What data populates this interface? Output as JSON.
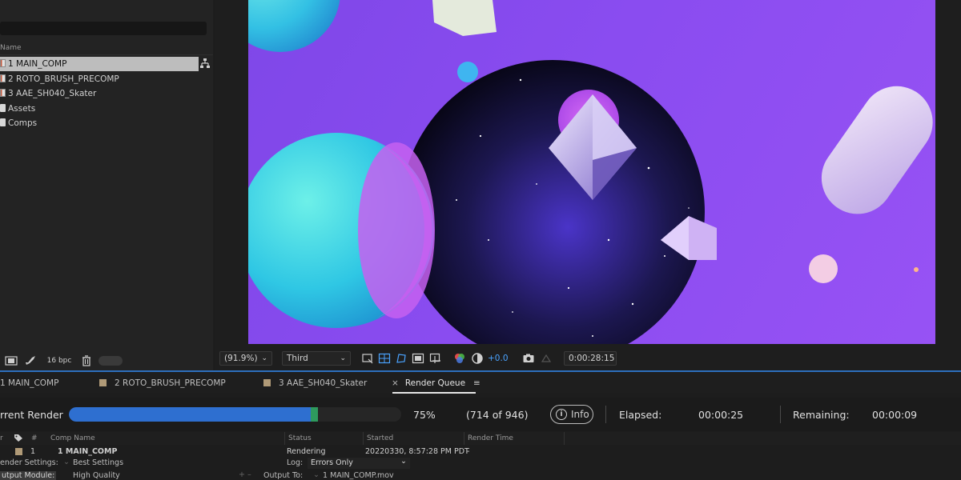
{
  "project": {
    "column_header": "Name",
    "items": [
      {
        "label": "1 MAIN_COMP",
        "type": "comp",
        "selected": true
      },
      {
        "label": "2 ROTO_BRUSH_PRECOMP",
        "type": "comp",
        "selected": false
      },
      {
        "label": "3 AAE_SH040_Skater",
        "type": "comp",
        "selected": false
      },
      {
        "label": "Assets",
        "type": "folder",
        "selected": false
      },
      {
        "label": "Comps",
        "type": "folder",
        "selected": false
      }
    ],
    "bpc": "16 bpc"
  },
  "viewer": {
    "zoom": "(91.9%)",
    "resolution": "Third",
    "exposure": "+0.0",
    "timecode": "0:00:28:15"
  },
  "tabs": [
    {
      "label": "1 MAIN_COMP"
    },
    {
      "label": "2 ROTO_BRUSH_PRECOMP"
    },
    {
      "label": "3 AAE_SH040_Skater"
    },
    {
      "label": "Render Queue",
      "active": true
    }
  ],
  "render_queue": {
    "title": "rrent Render",
    "progress": 0.75,
    "percent_label": "75%",
    "frames_label": "(714 of 946)",
    "info_label": "Info",
    "elapsed_label": "Elapsed:",
    "elapsed_value": "00:00:25",
    "remaining_label": "Remaining:",
    "remaining_value": "00:00:09",
    "columns": {
      "num": "#",
      "comp_name": "Comp Name",
      "status": "Status",
      "started": "Started",
      "render_time": "Render Time"
    },
    "item": {
      "num": "1",
      "comp_name": "1 MAIN_COMP",
      "status": "Rendering",
      "started": "20220330, 8:57:28 PM PDT",
      "render_time": "-"
    },
    "render_settings_label": "ender Settings:",
    "render_settings_value": "Best Settings",
    "log_label": "Log:",
    "log_value": "Errors Only",
    "output_module_label": "utput Module:",
    "output_module_value": "High Quality",
    "output_to_label": "Output To:",
    "output_to_value": "1 MAIN_COMP.mov"
  },
  "colors": {
    "accent": "#2d6fbd",
    "progress": "#2e6fd0",
    "progress_tip": "#2e9a5e",
    "label_swatch": "#b09a77"
  }
}
